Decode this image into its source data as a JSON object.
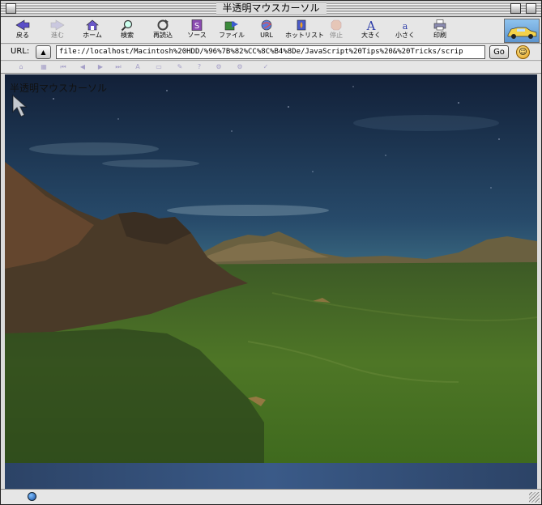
{
  "window": {
    "title": "半透明マウスカーソル"
  },
  "toolbar": {
    "buttons": [
      {
        "label": "戻る",
        "icon": "back-arrow-icon",
        "enabled": true
      },
      {
        "label": "進む",
        "icon": "forward-arrow-icon",
        "enabled": false
      },
      {
        "label": "ホーム",
        "icon": "home-icon",
        "enabled": true
      },
      {
        "label": "検索",
        "icon": "magnifier-icon",
        "enabled": true
      },
      {
        "label": "再読込",
        "icon": "reload-icon",
        "enabled": true
      },
      {
        "label": "ソース",
        "icon": "source-icon",
        "enabled": true
      },
      {
        "label": "ファイル",
        "icon": "file-icon",
        "enabled": true
      },
      {
        "label": "URL",
        "icon": "url-icon",
        "enabled": true
      },
      {
        "label": "ホットリスト",
        "icon": "hotlist-icon",
        "enabled": true
      },
      {
        "label": "停止",
        "icon": "stop-icon",
        "enabled": false
      },
      {
        "label": "大きく",
        "icon": "text-larger-icon",
        "enabled": true
      },
      {
        "label": "小さく",
        "icon": "text-smaller-icon",
        "enabled": true
      },
      {
        "label": "印刷",
        "icon": "print-icon",
        "enabled": true
      }
    ]
  },
  "address": {
    "label": "URL:",
    "value": "file://localhost/Macintosh%20HDD/%96%7B%82%CC%8C%B4%8De/JavaScript%20Tips%20&%20Tricks/scrip",
    "go_label": "Go"
  },
  "page": {
    "heading": "半透明マウスカーソル"
  },
  "colors": {
    "sky_top": "#16243a",
    "sky_mid": "#3e6f8a",
    "ground": "#4a6a22",
    "mountain": "#5a4030"
  }
}
